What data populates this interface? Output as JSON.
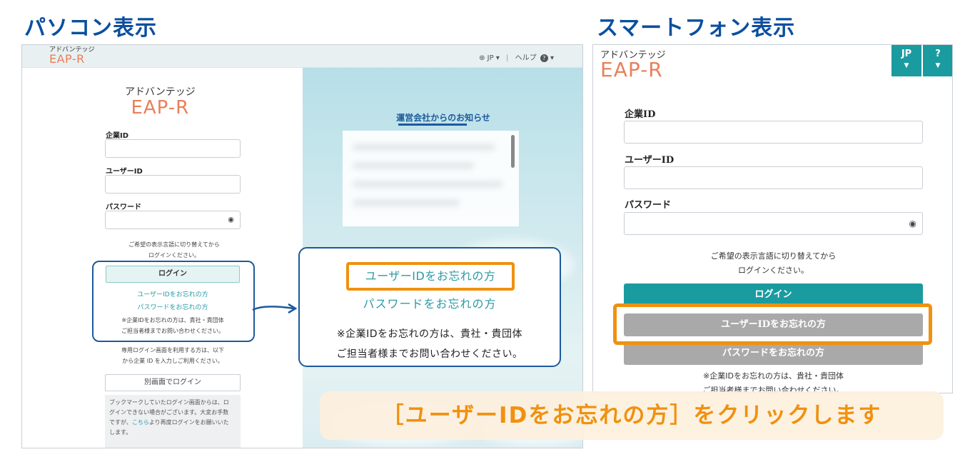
{
  "headings": {
    "pc": "パソコン表示",
    "smartphone": "スマートフォン表示"
  },
  "pc": {
    "logo": {
      "kana": "アドバンテッジ",
      "eap": "EAP-R"
    },
    "top_bar": {
      "lang": "JP",
      "sep": "|",
      "help": "ヘルプ"
    },
    "form": {
      "company_id_label": "企業ID",
      "user_id_label": "ユーザーID",
      "password_label": "パスワード",
      "lang_note_1": "ご希望の表示言語に切り替えてから",
      "lang_note_2": "ログインください。",
      "login_button": "ログイン",
      "forgot_user_id": "ユーザーIDをお忘れの方",
      "forgot_password": "パスワードをお忘れの方",
      "company_note_1": "※企業IDをお忘れの方は、貴社・貴団体",
      "company_note_2": "ご担当者様までお問い合わせください。",
      "dedicated_note_1": "専用ログイン画面を利用する方は、以下",
      "dedicated_note_2": "から企業 ID を入力しご利用ください。",
      "alt_login_button": "別画面でログイン",
      "bookmark_note_1": "ブックマークしていたログイン画面からは、ロ",
      "bookmark_note_2": "グインできない場合がございます。大変お手数",
      "bookmark_note_3a": "ですが、",
      "bookmark_note_link": "こちら",
      "bookmark_note_3b": "より再度ログインをお願いいた",
      "bookmark_note_4": "します。"
    },
    "news_title": "運営会社からのお知らせ",
    "zoom": {
      "forgot_user_id": "ユーザーIDをお忘れの方",
      "forgot_password": "パスワードをお忘れの方",
      "note_1": "※企業IDをお忘れの方は、貴社・貴団体",
      "note_2": "ご担当者様までお問い合わせください。"
    }
  },
  "smartphone": {
    "logo": {
      "kana": "アドバンテッジ",
      "eap": "EAP-R"
    },
    "top_buttons": {
      "lang": "JP",
      "help": "?"
    },
    "form": {
      "company_id_label": "企業ID",
      "user_id_label": "ユーザーID",
      "password_label": "パスワード",
      "lang_note_1": "ご希望の表示言語に切り替えてから",
      "lang_note_2": "ログインください。",
      "login_button": "ログイン",
      "forgot_user_id": "ユーザーIDをお忘れの方",
      "forgot_password": "パスワードをお忘れの方",
      "company_note_1": "※企業IDをお忘れの方は、貴社・貴団体",
      "company_note_2": "ご担当者様までお問い合わせください。"
    }
  },
  "banner": "［ユーザーIDをお忘れの方］をクリックします",
  "colors": {
    "heading": "#0a4fa0",
    "teal": "#1a9ba0",
    "link": "#2b9aa6",
    "highlight_orange": "#f0910f",
    "callout_blue": "#1d5a9c",
    "logo_orange": "#e8805a"
  },
  "icons": [
    "globe-icon",
    "help-circle-icon",
    "chevron-down-icon",
    "eye-icon",
    "arrow-icon"
  ]
}
